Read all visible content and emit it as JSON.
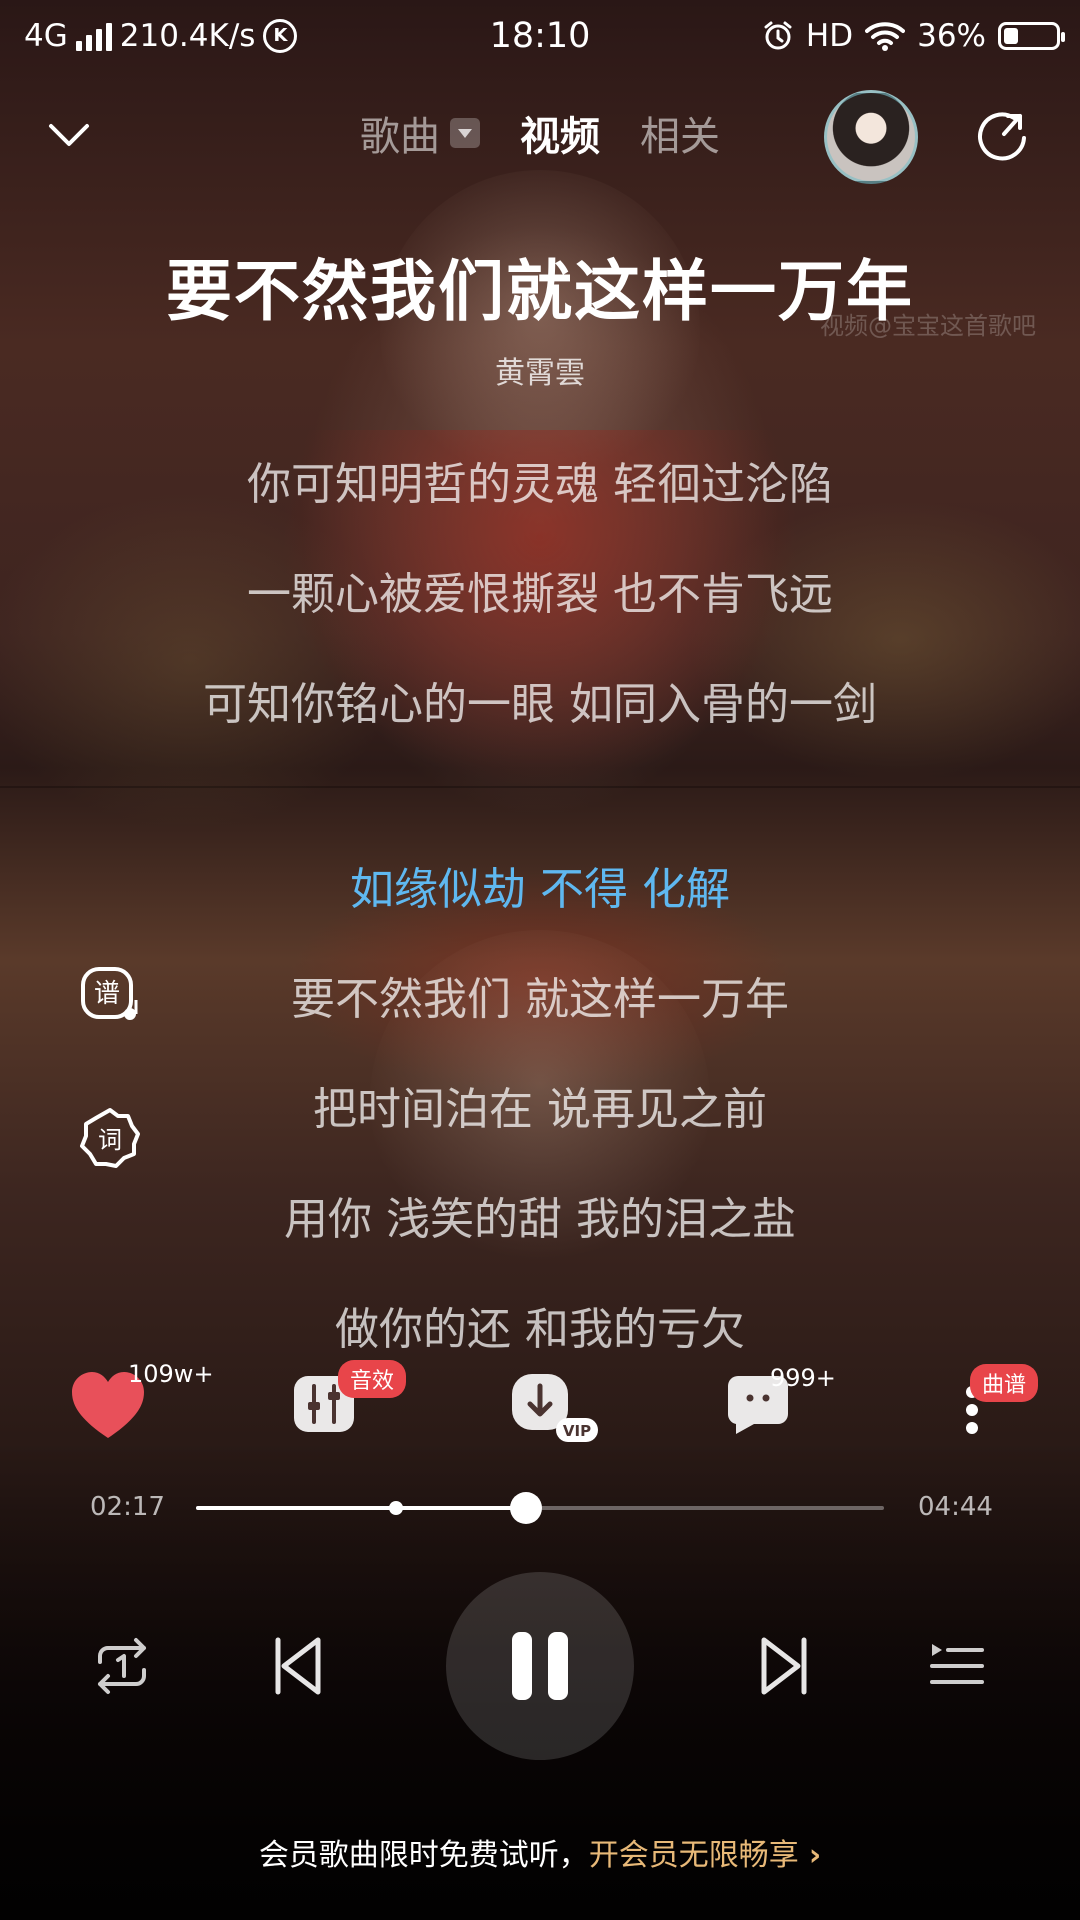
{
  "status_bar": {
    "network": "4G",
    "speed": "210.4K/s",
    "k_icon_letter": "K",
    "time": "18:10",
    "hd": "HD",
    "battery": "36%",
    "battery_level": 0.36
  },
  "nav": {
    "tabs": [
      {
        "label": "歌曲",
        "has_dropdown": true,
        "active": false
      },
      {
        "label": "视频",
        "active": true
      },
      {
        "label": "相关",
        "active": false
      }
    ]
  },
  "song": {
    "title": "要不然我们就这样一万年",
    "artist": "黄霄雲",
    "watermark": "视频@宝宝这首歌吧"
  },
  "lyrics": [
    {
      "text": "你可知明哲的灵魂 轻徊过沦陷",
      "current": false
    },
    {
      "text": "一颗心被爱恨撕裂 也不肯飞远",
      "current": false
    },
    {
      "text": "可知你铭心的一眼 如同入骨的一剑",
      "current": false
    },
    {
      "text": "如缘似劫 不得 化解",
      "current": true
    },
    {
      "text": "要不然我们 就这样一万年",
      "current": false
    },
    {
      "text": "把时间泊在 说再见之前",
      "current": false
    },
    {
      "text": "用你 浅笑的甜 我的泪之盐",
      "current": false
    },
    {
      "text": "做你的还 和我的亏欠",
      "current": false
    }
  ],
  "side_buttons": {
    "score": "谱",
    "lyric": "词"
  },
  "actions": {
    "like_count": "109w+",
    "effect_label": "音效",
    "vip_label": "VIP",
    "comment_count": "999+",
    "sheet_label": "曲谱"
  },
  "progress": {
    "elapsed": "02:17",
    "total": "04:44",
    "fraction": 0.48,
    "marker_fraction": 0.29
  },
  "promo": {
    "text_a": "会员歌曲限时免费试听，",
    "text_b": "开会员无限畅享",
    "chevron": "›"
  },
  "colors": {
    "current_lyric": "#5fb8f0",
    "badge_red": "#e8454a",
    "promo_gold": "#e8b978",
    "heart": "#e8505a"
  }
}
